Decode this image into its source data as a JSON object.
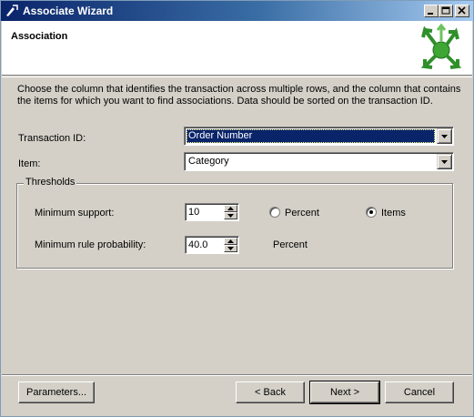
{
  "window": {
    "title": "Associate Wizard",
    "controls": {
      "minimize": "minimize",
      "maximize": "maximize",
      "close": "close"
    }
  },
  "header": {
    "title": "Association",
    "logo_icon": "wizard-arrows-icon"
  },
  "instructions": "Choose the column that identifies the transaction across multiple rows, and the column that contains the items for which you want to find associations. Data should be sorted on the transaction ID.",
  "fields": {
    "transaction_id": {
      "label": "Transaction ID:",
      "value": "Order Number"
    },
    "item": {
      "label": "Item:",
      "value": "Category"
    }
  },
  "thresholds": {
    "title": "Thresholds",
    "min_support": {
      "label": "Minimum support:",
      "value": "10",
      "options": [
        {
          "label": "Percent",
          "selected": false
        },
        {
          "label": "Items",
          "selected": true
        }
      ]
    },
    "min_rule_probability": {
      "label": "Minimum rule probability:",
      "value": "40.0",
      "unit": "Percent"
    }
  },
  "buttons": {
    "parameters": "Parameters...",
    "back": "< Back",
    "next": "Next >",
    "cancel": "Cancel"
  },
  "colors": {
    "titlebar_start": "#0a246a",
    "titlebar_end": "#a6caf0",
    "selection": "#0a246a",
    "face": "#d4d0c8",
    "logo_green": "#3fa535"
  }
}
